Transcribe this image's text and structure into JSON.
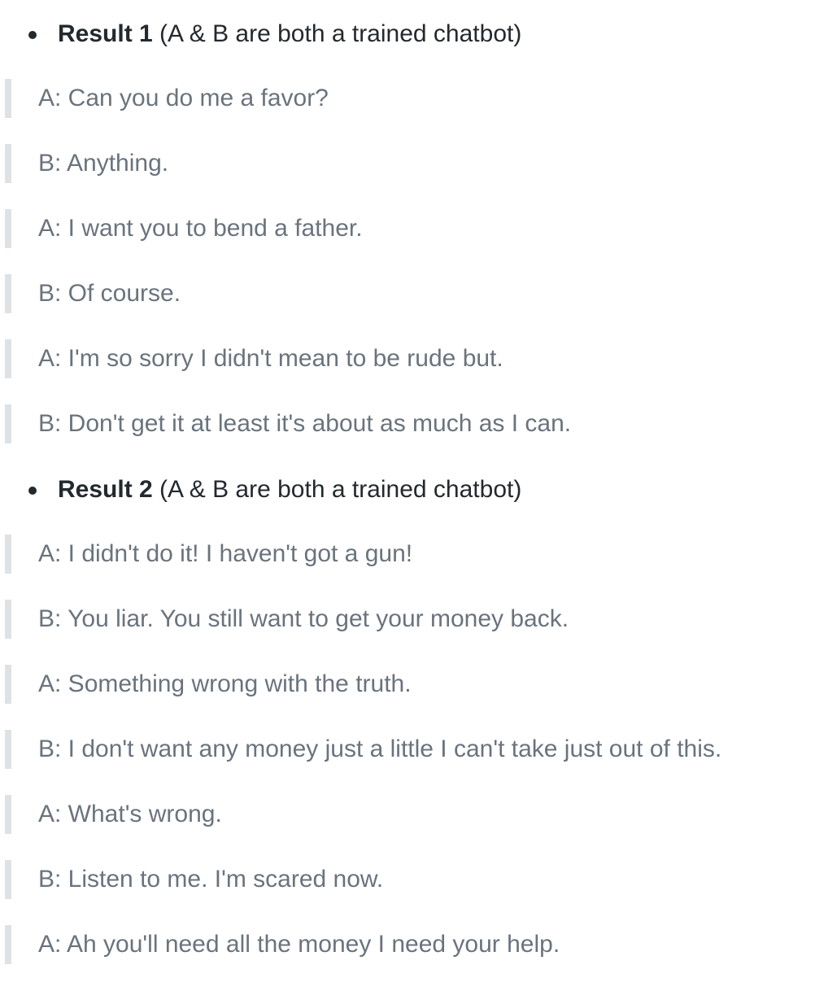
{
  "results": [
    {
      "title": "Result 1",
      "subtitle": " (A & B are both a trained chatbot)",
      "lines": [
        "A: Can you do me a favor?",
        "B: Anything.",
        "A: I want you to bend a father.",
        "B: Of course.",
        "A: I'm so sorry I didn't mean to be rude but.",
        "B: Don't get it at least it's about as much as I can."
      ]
    },
    {
      "title": "Result 2",
      "subtitle": " (A & B are both a trained chatbot)",
      "lines": [
        "A: I didn't do it! I haven't got a gun!",
        "B: You liar. You still want to get your money back.",
        "A: Something wrong with the truth.",
        "B: I don't want any money just a little I can't take just out of this.",
        "A: What's wrong.",
        "B: Listen to me. I'm scared now.",
        "A: Ah you'll need all the money I need your help."
      ]
    }
  ]
}
